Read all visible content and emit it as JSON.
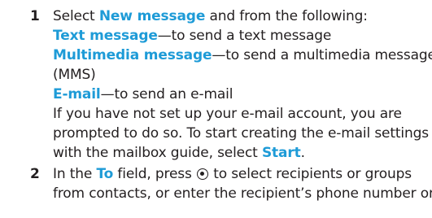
{
  "steps": [
    {
      "number": "1",
      "intro_before": "Select ",
      "intro_term": "New message",
      "intro_after": " and from the following:",
      "options": [
        {
          "term": "Text message",
          "desc": "—to send a text message"
        },
        {
          "term": "Multimedia message",
          "desc": "—to send a multimedia message"
        },
        {
          "term": "E-mail",
          "desc": "—to send an e-mail"
        }
      ],
      "mms_continuation": "(MMS)",
      "note_line1": "If you have not set up your e-mail account, you are",
      "note_line2": "prompted to do so. To start creating the e-mail settings",
      "note_line3_before": "with the mailbox guide, select ",
      "note_line3_term": "Start",
      "note_line3_after": "."
    },
    {
      "number": "2",
      "line1_before": "In the ",
      "line1_term": "To",
      "line1_mid": " field, press ",
      "line1_icon": "navigation-key-select-icon",
      "line1_after": " to select recipients or groups",
      "line2": "from contacts, or enter the recipient’s phone number or"
    }
  ],
  "colors": {
    "highlight": "#1e9bd7",
    "text": "#231f20"
  }
}
